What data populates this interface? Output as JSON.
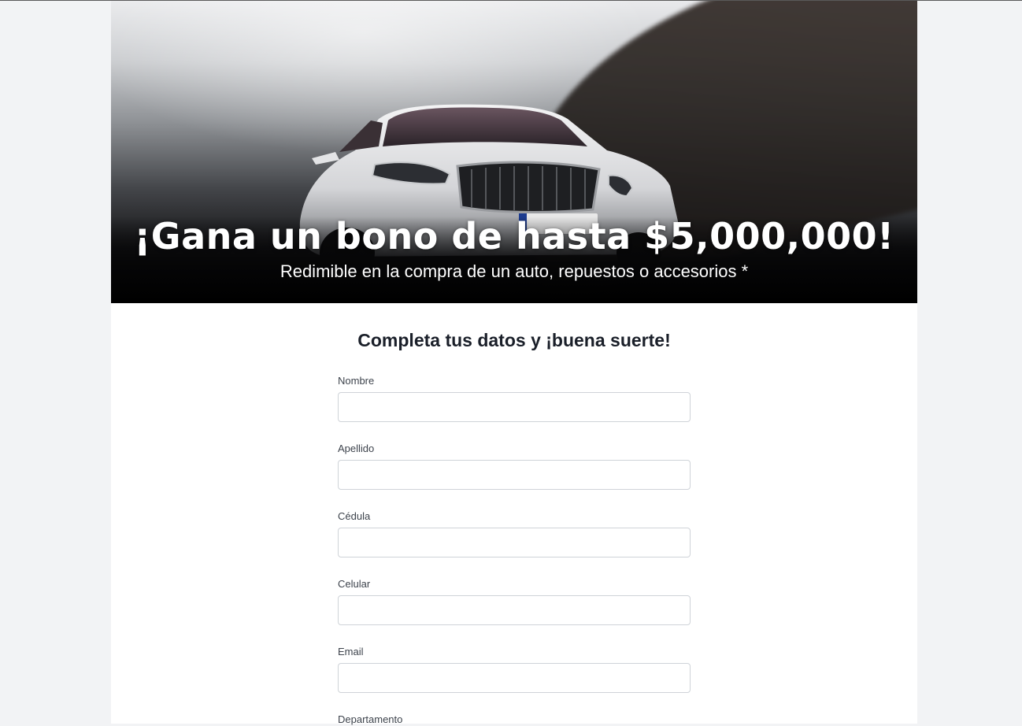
{
  "hero": {
    "title": "¡Gana un bono de hasta $5,000,000!",
    "subtitle": "Redimible en la compra de un auto, repuestos o accesorios *"
  },
  "form": {
    "title": "Completa tus datos y ¡buena suerte!",
    "fields": [
      {
        "label": "Nombre",
        "value": ""
      },
      {
        "label": "Apellido",
        "value": ""
      },
      {
        "label": "Cédula",
        "value": ""
      },
      {
        "label": "Celular",
        "value": ""
      },
      {
        "label": "Email",
        "value": ""
      },
      {
        "label": "Departamento"
      }
    ]
  }
}
